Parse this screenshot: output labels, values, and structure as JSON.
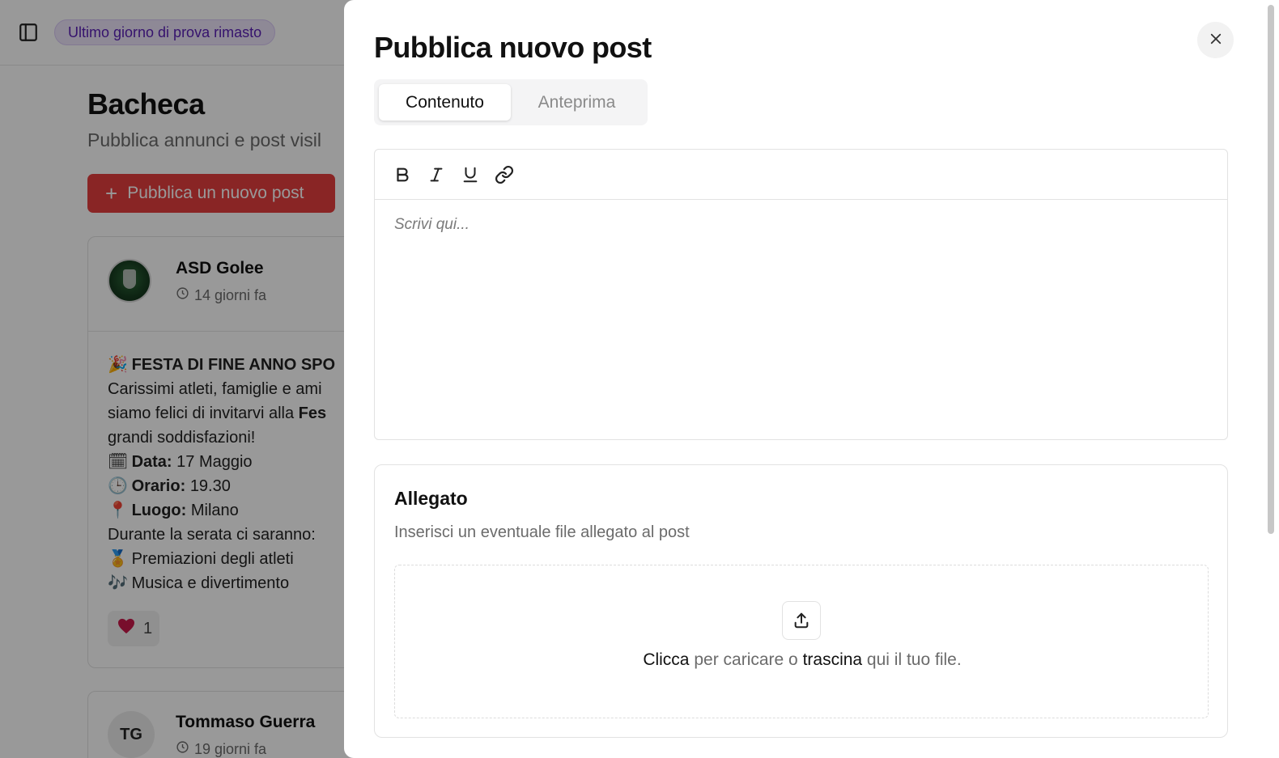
{
  "background": {
    "trial_badge": "Ultimo giorno di prova rimasto",
    "page_title": "Bacheca",
    "page_subtitle": "Pubblica annunci e post visil",
    "new_post_button": "Pubblica un nuovo post",
    "posts": [
      {
        "author": "ASD Golee",
        "time": "14 giorni fa",
        "lines": {
          "heading": "FESTA DI FINE ANNO SPO",
          "l1": "Carissimi atleti, famiglie e ami",
          "l2": "siamo felici di invitarvi alla",
          "l2_bold": "Fes",
          "l3": "grandi soddisfazioni!",
          "date_label": "Data:",
          "date_value": "17 Maggio",
          "time_label": "Orario:",
          "time_value": "19.30",
          "place_label": "Luogo:",
          "place_value": "Milano",
          "l4": "Durante la serata ci saranno:",
          "l5": "Premiazioni degli atleti",
          "l6": "Musica e divertimento"
        },
        "reaction_count": "1"
      },
      {
        "author": "Tommaso Guerra",
        "initials": "TG",
        "time": "19 giorni fa"
      }
    ]
  },
  "drawer": {
    "title": "Pubblica nuovo post",
    "tabs": [
      {
        "label": "Contenuto",
        "active": true
      },
      {
        "label": "Anteprima",
        "active": false
      }
    ],
    "editor": {
      "toolbar": [
        "bold-icon",
        "italic-icon",
        "underline-icon",
        "link-icon"
      ],
      "placeholder": "Scrivi qui..."
    },
    "attachment": {
      "title": "Allegato",
      "description": "Inserisci un eventuale file allegato al post",
      "drop_click": "Clicca",
      "drop_mid": " per caricare o ",
      "drop_drag": "trascina",
      "drop_end": " qui il tuo file."
    }
  },
  "colors": {
    "primary_red": "#e53e3e",
    "badge_bg": "#ede4fb",
    "badge_text": "#5b21b6",
    "overlay": "rgba(0,0,0,0.4)"
  }
}
